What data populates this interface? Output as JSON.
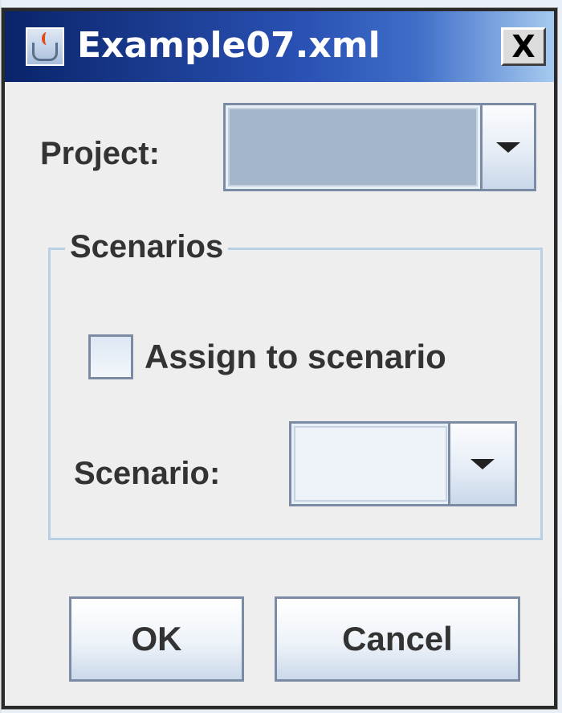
{
  "window": {
    "title": "Example07.xml",
    "close_glyph": "X",
    "icon": "java-cup-icon"
  },
  "form": {
    "project_label": "Project:",
    "project_value": "",
    "group_title": "Scenarios",
    "assign_checkbox_label": "Assign to scenario",
    "assign_checked": false,
    "scenario_label": "Scenario:",
    "scenario_value": ""
  },
  "buttons": {
    "ok_label": "OK",
    "cancel_label": "Cancel"
  },
  "colors": {
    "title_bar_start": "#0a246a",
    "title_bar_end": "#a6caf0",
    "dialog_background": "#eeeeee",
    "control_border": "#7a8ba3",
    "project_field_selected": "#a3b6cc"
  }
}
